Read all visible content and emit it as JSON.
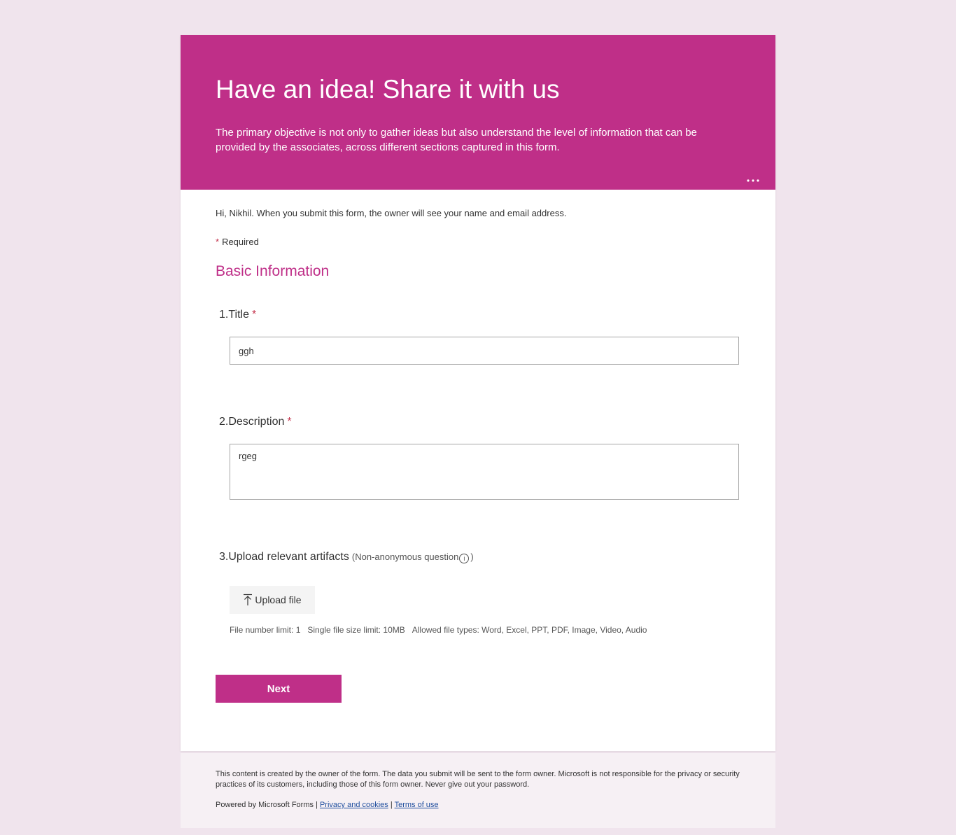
{
  "header": {
    "title": "Have an idea! Share it with us",
    "description": "The primary objective is not only to gather ideas but also understand the level of information that can be provided by the associates, across different sections captured in this form.",
    "more_label": "..."
  },
  "greeting": "Hi, Nikhil. When you submit this form, the owner will see your name and email address.",
  "required_note": {
    "star": "*",
    "label": "Required"
  },
  "section_title": "Basic Information",
  "questions": [
    {
      "number": "1.",
      "label": "Title",
      "required_star": "*",
      "value": "ggh"
    },
    {
      "number": "2.",
      "label": "Description",
      "required_star": "*",
      "value": "rgeg"
    },
    {
      "number": "3.",
      "label": "Upload relevant artifacts",
      "subtext": "(Non-anonymous question",
      "subtext_close": ")",
      "info_icon_glyph": "i",
      "upload_label": "Upload file",
      "limits": {
        "file_number": "File number limit: 1",
        "file_size": "Single file size limit: 10MB",
        "file_types": "Allowed file types: Word, Excel, PPT, PDF, Image, Video, Audio"
      }
    }
  ],
  "next_label": "Next",
  "footer": {
    "disclaimer": "This content is created by the owner of the form. The data you submit will be sent to the form owner. Microsoft is not responsible for the privacy or security practices of its customers, including those of this form owner. Never give out your password.",
    "powered_by": "Powered by Microsoft Forms |",
    "privacy_link": "Privacy and cookies",
    "separator": "|",
    "terms_link": "Terms of use"
  },
  "colors": {
    "brand": "#bf2f88",
    "background": "#f0e4ed",
    "required": "#c4314b",
    "link": "#1f4e9e"
  }
}
